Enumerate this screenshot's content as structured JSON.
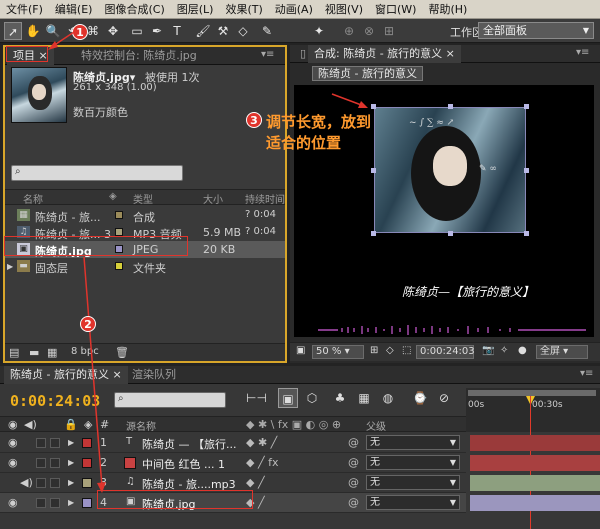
{
  "menu": [
    "文件(F)",
    "编辑(E)",
    "图像合成(C)",
    "图层(L)",
    "效果(T)",
    "动画(A)",
    "视图(V)",
    "窗口(W)",
    "帮助(H)"
  ],
  "toolbar": {
    "workspace_label": "工作区:",
    "workspace_value": "全部面板"
  },
  "project": {
    "tab_project": "项目",
    "tab_effects": "特效控制台: 陈绮贞.jpg",
    "file_name": "陈绮贞.jpg▾",
    "used": "被使用 1次",
    "dims": "261 x 348 (1.00)",
    "colors": "数百万颜色",
    "columns": {
      "name": "名称",
      "type": "类型",
      "size": "大小",
      "duration": "持续时间"
    },
    "rows": [
      {
        "name": "陈绮贞 - 旅...",
        "type": "合成",
        "size": "",
        "duration": "? 0:04",
        "color": "#9b8b5a"
      },
      {
        "name": "陈绮贞 - 旅... 3",
        "type": "MP3 音频",
        "size": "5.9 MB",
        "duration": "? 0:04",
        "color": "#a8a17a"
      },
      {
        "name": "陈绮贞.jpg",
        "type": "JPEG",
        "size": "20 KB",
        "duration": "",
        "color": "#9a93c7"
      },
      {
        "name": "固态层",
        "type": "文件夹",
        "size": "",
        "duration": "",
        "color": "#d6cf3a"
      }
    ],
    "footer_bpc": "8 bpc"
  },
  "comp": {
    "tab": "合成: 陈绮贞 - 旅行的意义",
    "subtab": "陈绮贞 - 旅行的意义",
    "title_text": "陈绮贞—【旅行的意义】",
    "zoom": "50 %",
    "timecode": "0:00:24:03",
    "resolution": "全屏"
  },
  "timeline": {
    "tab_comp": "陈绮贞 - 旅行的意义",
    "tab_render": "渲染队列",
    "time": "0:00:24:03",
    "col_source": "源名称",
    "col_parent": "父级",
    "ruler": [
      "00s",
      "00:30s"
    ],
    "layers": [
      {
        "num": "1",
        "name": "陈绮贞 — 【旅行...",
        "color": "#c33636",
        "parent": "无",
        "type": "text",
        "bar": "#9a3a3a"
      },
      {
        "num": "2",
        "name": "中间色 红色 ... 1",
        "color": "#c33636",
        "parent": "无",
        "type": "solid",
        "bar": "#a84040"
      },
      {
        "num": "3",
        "name": "陈绮贞 - 旅....mp3",
        "color": "#a8a17a",
        "parent": "无",
        "type": "audio",
        "bar": "#8d9f7f"
      },
      {
        "num": "4",
        "name": "陈绮贞.jpg",
        "color": "#9a93c7",
        "parent": "无",
        "type": "image",
        "bar": "#9b96be"
      }
    ]
  },
  "annotations": {
    "badge1": "1",
    "badge2": "2",
    "badge3": "3",
    "note": "调节长宽，放到适合的位置",
    "colors": {
      "red": "#e0342c",
      "orange": "#ff9a2e"
    }
  }
}
